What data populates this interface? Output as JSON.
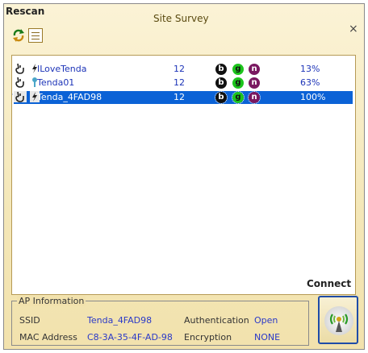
{
  "window": {
    "rescan_label": "Rescan",
    "title": "Site Survey",
    "close_glyph": "×"
  },
  "toolbar": {
    "icons": [
      "refresh-icon",
      "list-icon"
    ]
  },
  "networks": [
    {
      "ssid": "ILoveTenda",
      "channel": "12",
      "modes": [
        "b",
        "g",
        "n"
      ],
      "security_icon": "lightning-icon",
      "signal": "13%",
      "selected": false
    },
    {
      "ssid": "Tenda01",
      "channel": "12",
      "modes": [
        "b",
        "g",
        "n"
      ],
      "security_icon": "key-icon",
      "signal": "63%",
      "selected": false
    },
    {
      "ssid": "Tenda_4FAD98",
      "channel": "12",
      "modes": [
        "b",
        "g",
        "n"
      ],
      "security_icon": "lightning-icon",
      "signal": "100%",
      "selected": true
    }
  ],
  "ap_info": {
    "legend": "AP Information",
    "ssid_label": "SSID",
    "ssid_value": "Tenda_4FAD98",
    "mac_label": "MAC Address",
    "mac_value": "C8-3A-35-4F-AD-98",
    "auth_label": "Authentication",
    "auth_value": "Open",
    "enc_label": "Encryption",
    "enc_value": "NONE"
  },
  "connect": {
    "label": "Connect",
    "icon": "wireless-antenna-icon"
  },
  "colors": {
    "selection": "#0b62d6",
    "link_text": "#1d34b8",
    "b_badge": "#111111",
    "g_badge": "#1dc41d",
    "n_badge": "#7a1860"
  }
}
